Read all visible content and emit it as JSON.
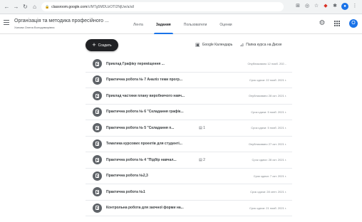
{
  "browser": {
    "url_host": "classroom.google.com",
    "url_path": "/c/MTg5MDUzOTI2NjUw/a/all"
  },
  "appbar": {
    "class_title": "Організація та методика професійного ...",
    "class_subtitle": "Ханова Олена Володимирівна",
    "tabs": [
      {
        "label": "Лента"
      },
      {
        "label": "Задания"
      },
      {
        "label": "Пользователи"
      },
      {
        "label": "Оценки"
      }
    ],
    "avatar_letter": "О"
  },
  "toolbar": {
    "create_label": "Создать",
    "calendar_label": "Google Календарь",
    "drive_label": "Папка курса на Диске"
  },
  "assignments": [
    {
      "title": "Приклад Графіку переміщення ...",
      "badge": "",
      "status": "Опубликовано 12 нояб. 202..."
    },
    {
      "title": "Практична робота № 7 Аналіз теми прогр...",
      "badge": "",
      "status": "Срок сдачи: 22 нояб. 2021 г."
    },
    {
      "title": "Приклад частини плану виробничого навч...",
      "badge": "",
      "status": "Опубликовано 28 окт. 2021 г."
    },
    {
      "title": "Практична робота № 6 \"Складання графік...",
      "badge": "",
      "status": "Срок сдачи: 5 нояб. 2021 г."
    },
    {
      "title": "Практична робота № 5 \"Складання п...",
      "badge": "▤ 1",
      "status": "Срок сдачи: 5 нояб. 2021 г."
    },
    {
      "title": "Тематика курсових проектів для студенті...",
      "badge": "",
      "status": "Опубликовано 27 окт. 2021 г."
    },
    {
      "title": "Практична робота № 4 \"Підбір навчал...",
      "badge": "▤ 2",
      "status": "Срок сдачи: 28 окт. 2021 г."
    },
    {
      "title": "Практична робота №2,3",
      "badge": "",
      "status": "Срок сдачи: 7 окт. 2021 г."
    },
    {
      "title": "Практична робота №1",
      "badge": "",
      "status": "Срок сдачи: 28 сент. 2021 г."
    },
    {
      "title": "Контрольна робота для заочної форми на...",
      "badge": "",
      "status": "Срок сдачи: 21 нояб. 2021 г."
    }
  ]
}
